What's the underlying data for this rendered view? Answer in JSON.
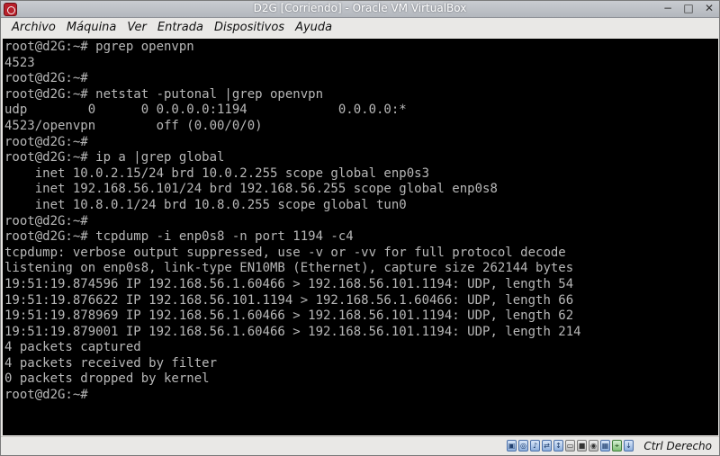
{
  "window": {
    "title": "D2G [Corriendo] - Oracle VM VirtualBox",
    "controls": [
      "−",
      "□",
      "✕"
    ]
  },
  "menu": {
    "items": [
      "Archivo",
      "Máquina",
      "Ver",
      "Entrada",
      "Dispositivos",
      "Ayuda"
    ]
  },
  "terminal": {
    "lines": [
      "root@d2G:~# pgrep openvpn",
      "4523",
      "root@d2G:~#",
      "root@d2G:~# netstat -putonal |grep openvpn",
      "udp        0      0 0.0.0.0:1194            0.0.0.0:*",
      "4523/openvpn        off (0.00/0/0)",
      "root@d2G:~#",
      "root@d2G:~# ip a |grep global",
      "    inet 10.0.2.15/24 brd 10.0.2.255 scope global enp0s3",
      "    inet 192.168.56.101/24 brd 192.168.56.255 scope global enp0s8",
      "    inet 10.8.0.1/24 brd 10.8.0.255 scope global tun0",
      "root@d2G:~#",
      "root@d2G:~# tcpdump -i enp0s8 -n port 1194 -c4",
      "tcpdump: verbose output suppressed, use -v or -vv for full protocol decode",
      "listening on enp0s8, link-type EN10MB (Ethernet), capture size 262144 bytes",
      "19:51:19.874596 IP 192.168.56.1.60466 > 192.168.56.101.1194: UDP, length 54",
      "19:51:19.876622 IP 192.168.56.101.1194 > 192.168.56.1.60466: UDP, length 66",
      "19:51:19.878969 IP 192.168.56.1.60466 > 192.168.56.101.1194: UDP, length 62",
      "19:51:19.879001 IP 192.168.56.1.60466 > 192.168.56.101.1194: UDP, length 214",
      "4 packets captured",
      "4 packets received by filter",
      "0 packets dropped by kernel",
      "root@d2G:~#"
    ]
  },
  "statusbar": {
    "icons": [
      {
        "name": "hard-disk-icon",
        "glyph": "▣"
      },
      {
        "name": "optical-drive-icon",
        "glyph": "◎"
      },
      {
        "name": "audio-icon",
        "glyph": "♪"
      },
      {
        "name": "network-icon",
        "glyph": "⇄"
      },
      {
        "name": "usb-icon",
        "glyph": "↕"
      },
      {
        "name": "shared-folders-icon",
        "glyph": "▭"
      },
      {
        "name": "display-icon",
        "glyph": "■"
      },
      {
        "name": "video-capture-icon",
        "glyph": "◉"
      },
      {
        "name": "cpu-icon",
        "glyph": "▦"
      },
      {
        "name": "mouse-integration-icon",
        "glyph": "⌖"
      },
      {
        "name": "keyboard-capture-icon",
        "glyph": "↓"
      }
    ],
    "host_key": "Ctrl Derecho"
  },
  "colors": {
    "terminal_bg": "#000000",
    "terminal_fg": "#b8b8b8",
    "titlebar": "#bfc3c8"
  }
}
